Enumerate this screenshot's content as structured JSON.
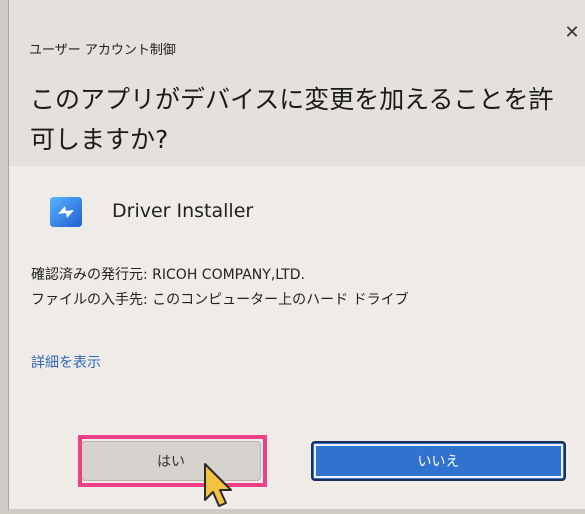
{
  "dialog": {
    "title": "ユーザー アカウント制御",
    "question": "このアプリがデバイスに変更を加えることを許可しますか?",
    "app_name": "Driver Installer",
    "publisher_line": "確認済みの発行元: RICOH COMPANY,LTD.",
    "source_line": "ファイルの入手先: このコンピューター上のハード ドライブ",
    "details_link": "詳細を表示",
    "yes_button": "はい",
    "no_button": "いいえ"
  },
  "icons": {
    "close": "close-icon",
    "app": "app-icon",
    "cursor": "cursor-icon"
  },
  "colors": {
    "highlight": "#ef3f86",
    "primary_button": "#2f73cf",
    "link": "#2f67b8"
  }
}
